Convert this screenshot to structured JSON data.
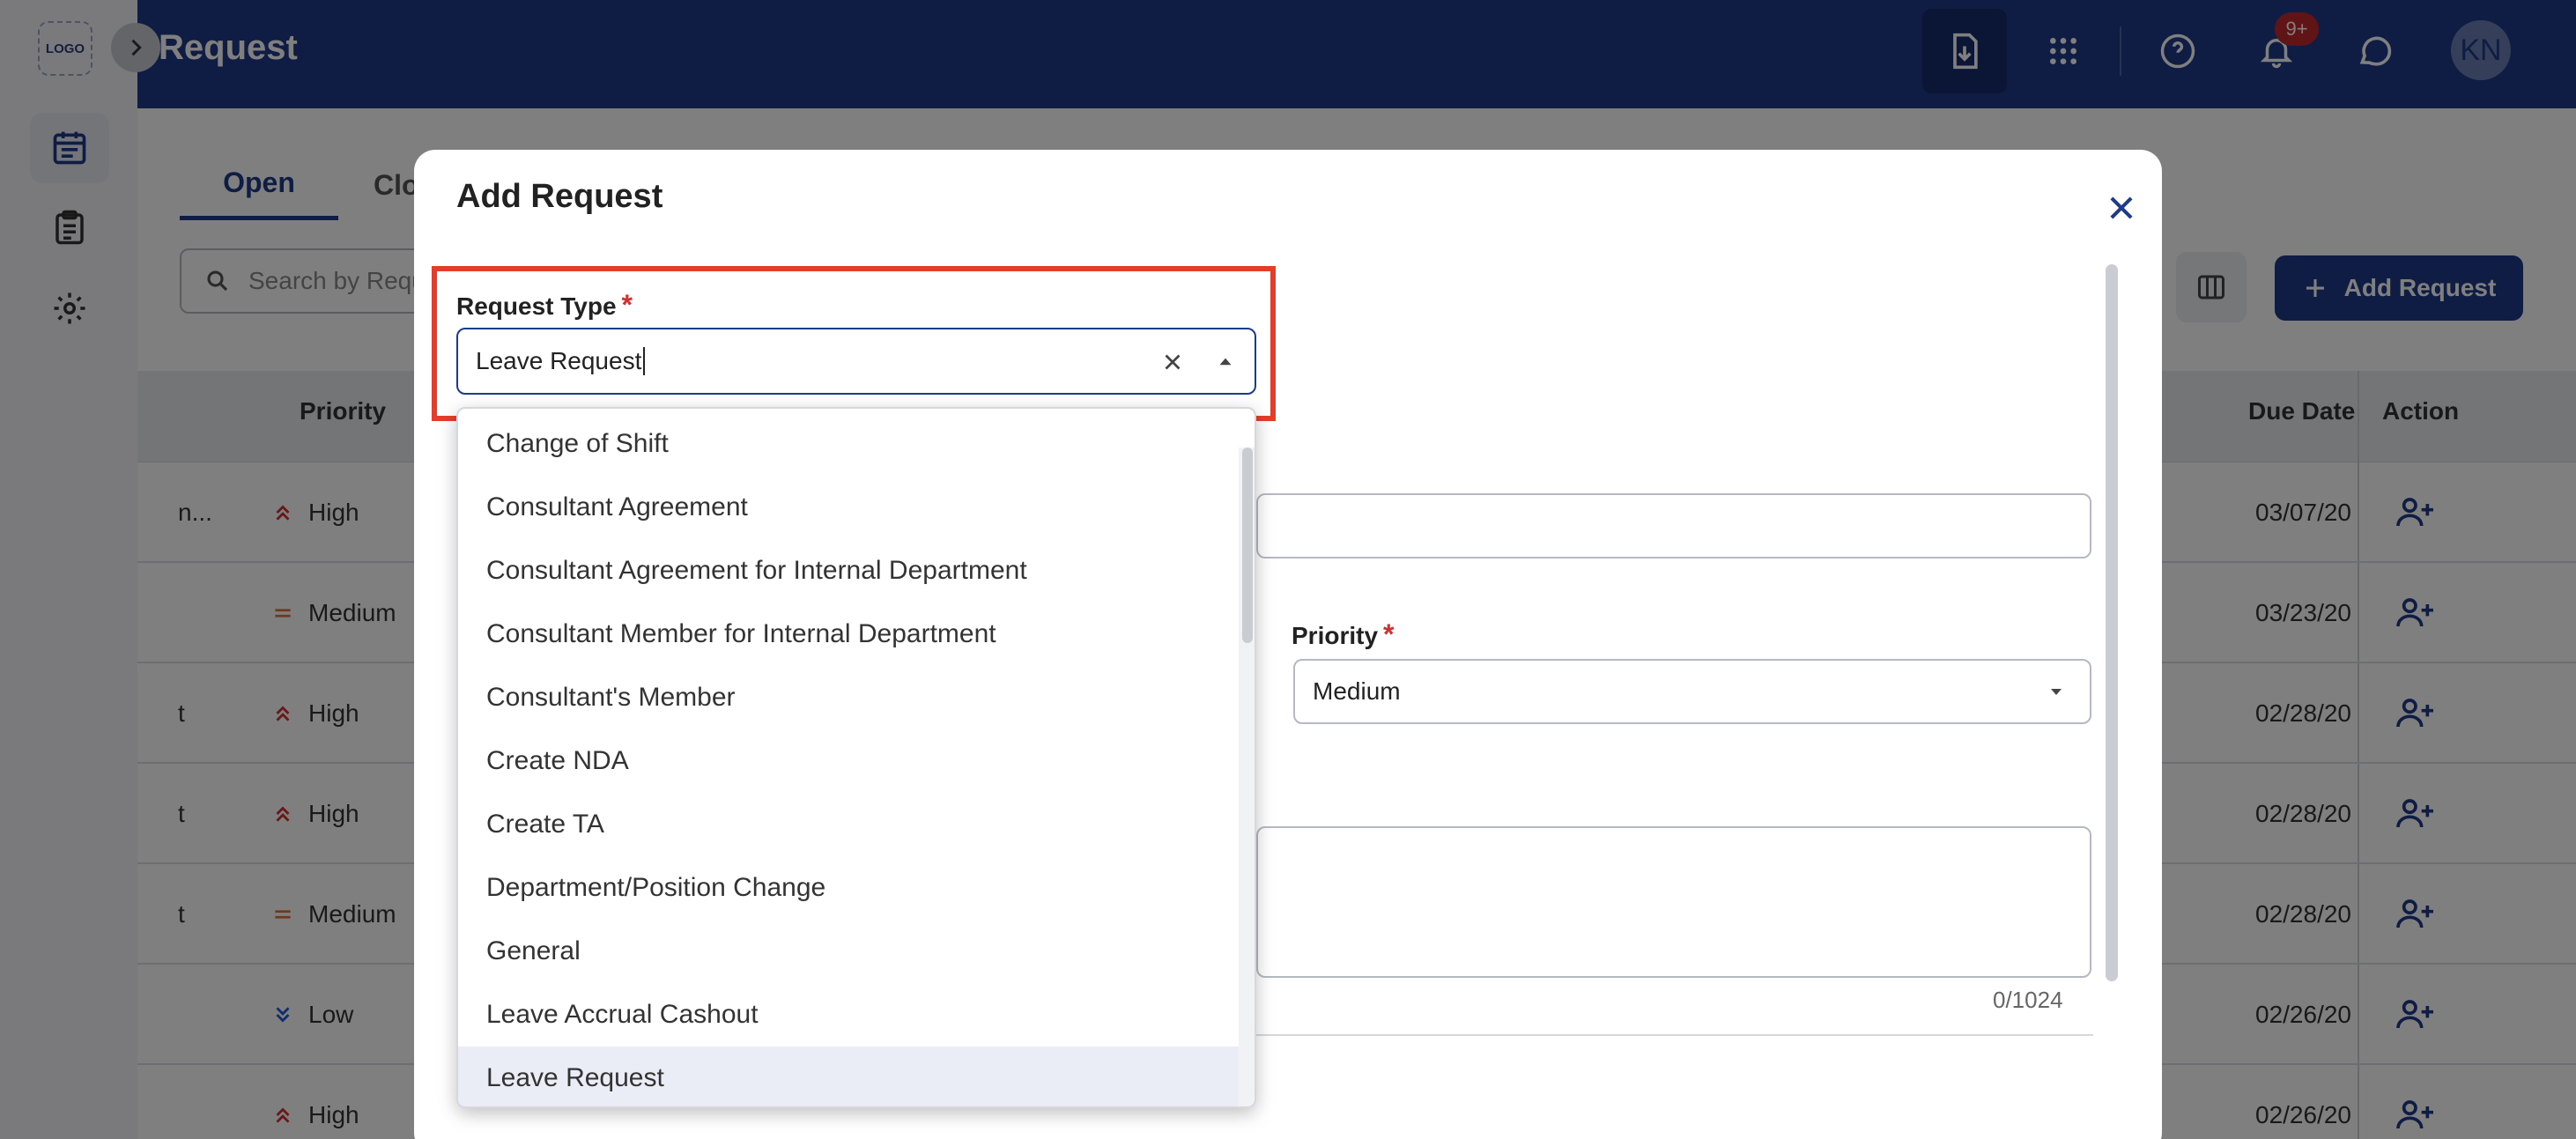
{
  "sidebar": {
    "logo": "LOGO"
  },
  "header": {
    "title": "Request",
    "notification_count": "9+",
    "avatar_initials": "KN"
  },
  "tabs": {
    "open": "Open",
    "closed": "Clo"
  },
  "search": {
    "placeholder": "Search by Requ"
  },
  "toolbar": {
    "add_request": "Add Request"
  },
  "table": {
    "headers": {
      "priority": "Priority",
      "due_date": "Due Date",
      "action": "Action"
    },
    "rows": [
      {
        "left": "n...",
        "priority": "High",
        "due": "03/07/20"
      },
      {
        "left": "",
        "priority": "Medium",
        "due": "03/23/20"
      },
      {
        "left": "t",
        "priority": "High",
        "due": "02/28/20"
      },
      {
        "left": "t",
        "priority": "High",
        "due": "02/28/20"
      },
      {
        "left": "t",
        "priority": "Medium",
        "due": "02/28/20"
      },
      {
        "left": "",
        "priority": "Low",
        "due": "02/26/20"
      },
      {
        "left": "",
        "priority": "High",
        "due": "02/26/20"
      }
    ]
  },
  "modal": {
    "title": "Add Request",
    "request_type": {
      "label": "Request Type",
      "required": "*",
      "value": "Leave Request"
    },
    "priority": {
      "label": "Priority",
      "required": "*",
      "value": "Medium"
    },
    "description_counter": "0/1024",
    "options": [
      "Change of Shift",
      "Consultant Agreement",
      "Consultant Agreement for Internal Department",
      "Consultant Member for Internal Department",
      "Consultant's Member",
      "Create NDA",
      "Create TA",
      "Department/Position Change",
      "General",
      "Leave Accrual Cashout",
      "Leave Request"
    ],
    "selected_option": "Leave Request"
  },
  "colors": {
    "brand": "#1e3a8a",
    "highlight": "#e53d2c",
    "high": "#d32f2f",
    "medium": "#e0703a",
    "low": "#1e5bd6"
  }
}
